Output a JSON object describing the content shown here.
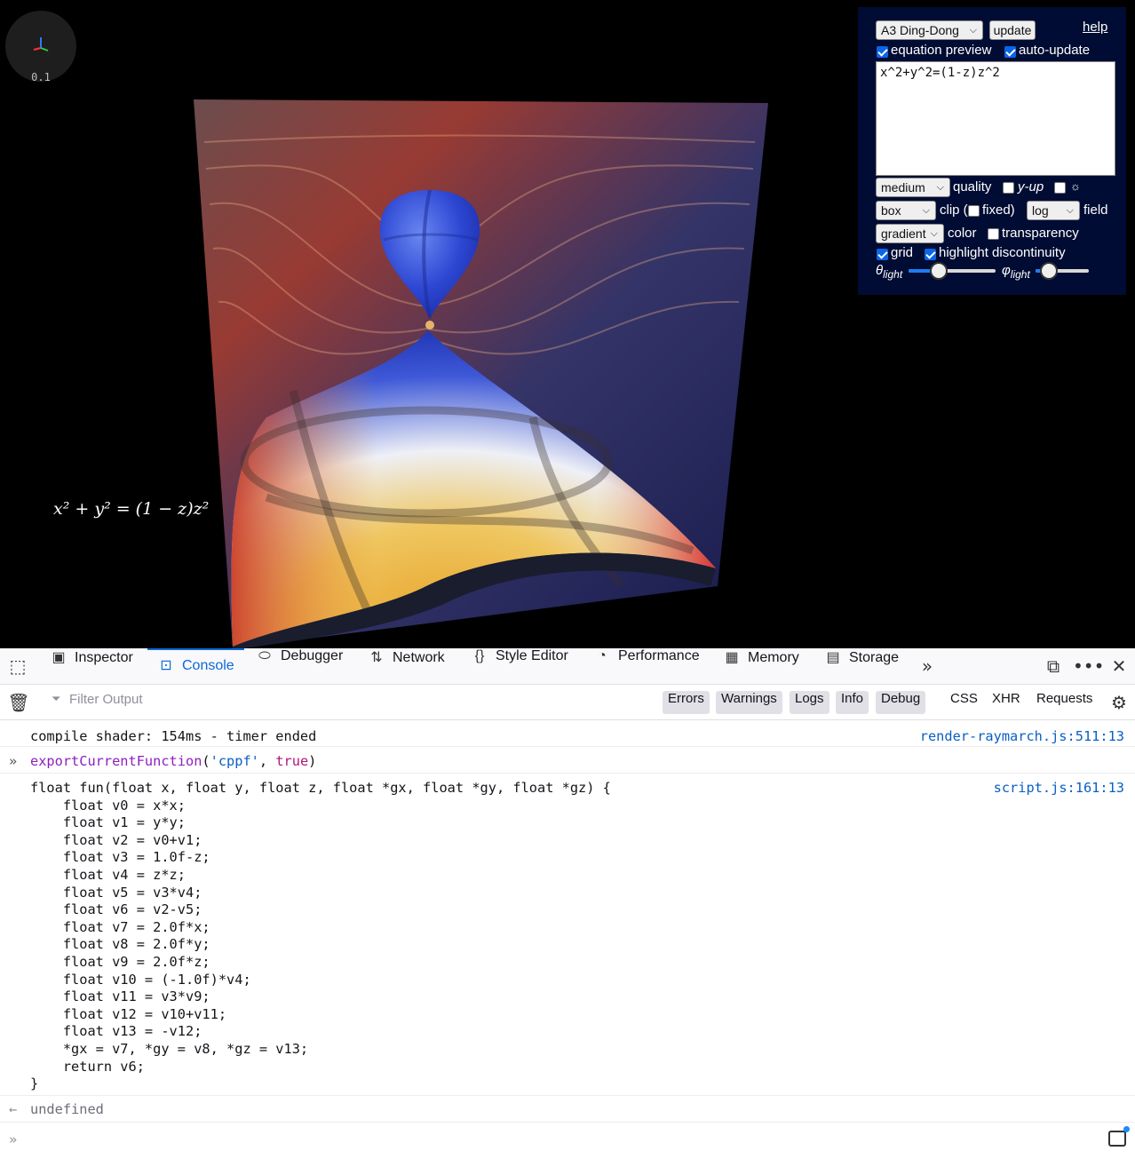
{
  "viewport": {
    "scale_label": "0.1",
    "equation_preview": "x² + y² = (1 − z)z²"
  },
  "panel": {
    "preset": "A3 Ding-Dong",
    "update_label": "update",
    "help_label": "help",
    "equation_preview_label": "equation preview",
    "equation_preview_checked": true,
    "auto_update_label": "auto-update",
    "auto_update_checked": true,
    "equation": "x^2+y^2=(1-z)z^2",
    "quality": "medium",
    "quality_label": "quality",
    "y_up_label": "y-up",
    "y_up_checked": false,
    "sun_icon": "☼",
    "sun_checked": false,
    "clip": "box",
    "clip_label": "clip (",
    "fixed_label": "fixed)",
    "fixed_checked": false,
    "field": "log",
    "field_label": "field",
    "color": "gradient",
    "color_label": "color",
    "transparency_label": "transparency",
    "transparency_checked": false,
    "grid_label": "grid",
    "grid_checked": true,
    "highlight_label": "highlight discontinuity",
    "highlight_checked": true,
    "theta_label": "θ",
    "theta_sub": "light",
    "theta_value": 0.35,
    "phi_label": "φ",
    "phi_sub": "light",
    "phi_value": 0.25
  },
  "devtools": {
    "tabs": [
      {
        "label": "Inspector",
        "icon": "inspector-icon"
      },
      {
        "label": "Console",
        "icon": "console-icon",
        "active": true
      },
      {
        "label": "Debugger",
        "icon": "debugger-icon"
      },
      {
        "label": "Network",
        "icon": "network-icon"
      },
      {
        "label": "Style Editor",
        "icon": "style-editor-icon"
      },
      {
        "label": "Performance",
        "icon": "performance-icon"
      },
      {
        "label": "Memory",
        "icon": "memory-icon"
      },
      {
        "label": "Storage",
        "icon": "storage-icon"
      }
    ],
    "filter_placeholder": "Filter Output",
    "filters": [
      "Errors",
      "Warnings",
      "Logs",
      "Info",
      "Debug"
    ],
    "net_filters": [
      "CSS",
      "XHR",
      "Requests"
    ],
    "messages": {
      "timer": "compile shader: 154ms - timer ended",
      "timer_loc": "render-raymarch.js:511:13",
      "input_fn": "exportCurrentFunction",
      "input_arg1": "'cppf'",
      "input_arg2": "true",
      "code_loc": "script.js:161:13",
      "code_lines": [
        "float fun(float x, float y, float z, float *gx, float *gy, float *gz) {",
        "    float v0 = x*x;",
        "    float v1 = y*y;",
        "    float v2 = v0+v1;",
        "    float v3 = 1.0f-z;",
        "    float v4 = z*z;",
        "    float v5 = v3*v4;",
        "    float v6 = v2-v5;",
        "    float v7 = 2.0f*x;",
        "    float v8 = 2.0f*y;",
        "    float v9 = 2.0f*z;",
        "    float v10 = (-1.0f)*v4;",
        "    float v11 = v3*v9;",
        "    float v12 = v10+v11;",
        "    float v13 = -v12;",
        "    *gx = v7, *gy = v8, *gz = v13;",
        "    return v6;",
        "}"
      ],
      "result": "undefined"
    }
  }
}
